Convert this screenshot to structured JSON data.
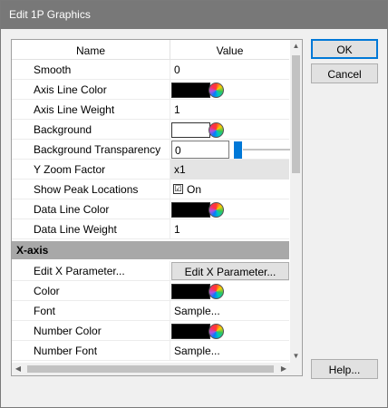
{
  "window": {
    "title": "Edit 1P Graphics"
  },
  "grid": {
    "header": {
      "name": "Name",
      "value": "Value"
    },
    "rows": [
      {
        "name": "Smooth",
        "value": "0"
      },
      {
        "name": "Axis Line Color",
        "color": "#000000"
      },
      {
        "name": "Axis Line Weight",
        "value": "1"
      },
      {
        "name": "Background",
        "color": "#ffffff"
      },
      {
        "name": "Background Transparency",
        "value": "0"
      },
      {
        "name": "Y Zoom Factor",
        "value": "x1"
      },
      {
        "name": "Show Peak Locations",
        "value": "On",
        "checked": true
      },
      {
        "name": "Data Line Color",
        "color": "#000000"
      },
      {
        "name": "Data Line Weight",
        "value": "1"
      }
    ],
    "section_x_axis": "X-axis",
    "x_axis_rows": [
      {
        "name": "Edit X Parameter...",
        "button": "Edit X Parameter..."
      },
      {
        "name": "Color",
        "color": "#000000"
      },
      {
        "name": "Font",
        "value": "Sample..."
      },
      {
        "name": "Number Color",
        "color": "#000000"
      },
      {
        "name": "Number Font",
        "value": "Sample..."
      }
    ],
    "checkbox_glyph": "☑"
  },
  "buttons": {
    "ok": "OK",
    "cancel": "Cancel",
    "help": "Help..."
  },
  "icons": {
    "up": "▲",
    "down": "▼",
    "left": "◀",
    "right": "▶"
  }
}
